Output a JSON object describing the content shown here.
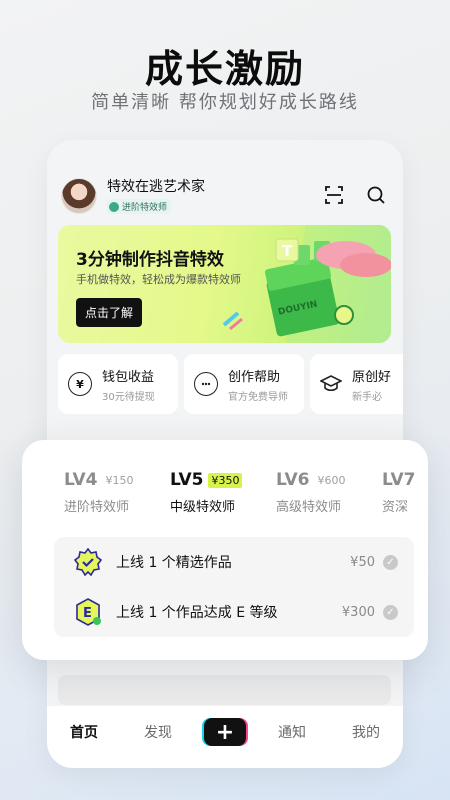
{
  "hero": {
    "title": "成长激励",
    "subtitle": "简单清晰 帮你规划好成长路线"
  },
  "profile": {
    "username": "特效在逃艺术家",
    "level_tag": "进阶特效师"
  },
  "header_icons": [
    "scan-icon",
    "search-icon"
  ],
  "banner": {
    "title": "3分钟制作抖音特效",
    "subtitle": "手机做特效，轻松成为爆款特效师",
    "button": "点击了解",
    "box_text": "DOUYIN",
    "bubble_letter": "T"
  },
  "quick_cards": [
    {
      "icon": "yen-icon",
      "title": "钱包收益",
      "sub": "30元待提现"
    },
    {
      "icon": "chat-help-icon",
      "title": "创作帮助",
      "sub": "官方免费导师"
    },
    {
      "icon": "graduation-cap-icon",
      "title": "原创好",
      "sub": "新手必"
    }
  ],
  "levels": [
    {
      "name": "LV4",
      "price": "¥150",
      "title": "进阶特效师",
      "active": false
    },
    {
      "name": "LV5",
      "price": "¥350",
      "title": "中级特效师",
      "active": true
    },
    {
      "name": "LV6",
      "price": "¥600",
      "title": "高级特效师",
      "active": false
    },
    {
      "name": "LV7",
      "price": "",
      "title": "资深",
      "active": false
    }
  ],
  "tasks": [
    {
      "text": "上线 1 个精选作品",
      "reward": "¥50",
      "badge": "check-star-badge-icon"
    },
    {
      "text": "上线 1 个作品达成 E 等级",
      "reward": "¥300",
      "badge": "grade-e-badge-icon",
      "badge_letter": "E"
    }
  ],
  "tabbar": {
    "items": [
      "首页",
      "发现",
      "+",
      "通知",
      "我的"
    ],
    "active": "首页"
  },
  "colors": {
    "accent_lime": "#d8f24a",
    "banner_green": "#e4f98a",
    "dark": "#111111"
  }
}
